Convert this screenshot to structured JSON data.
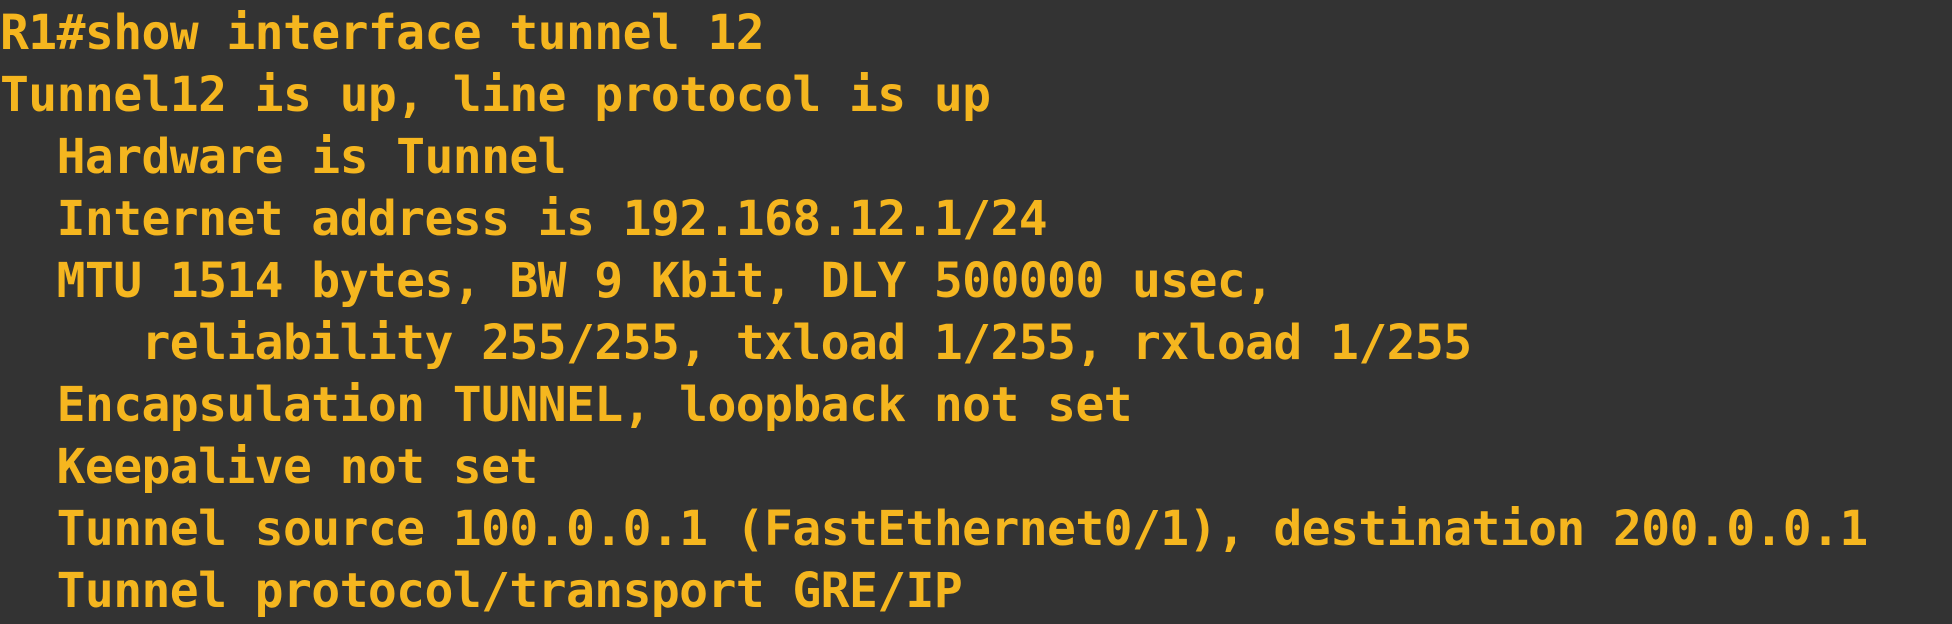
{
  "terminal": {
    "text_color": "#F5B61F",
    "background_color": "#333333",
    "lines": [
      "R1#show interface tunnel 12",
      "Tunnel12 is up, line protocol is up",
      "  Hardware is Tunnel",
      "  Internet address is 192.168.12.1/24",
      "  MTU 1514 bytes, BW 9 Kbit, DLY 500000 usec,",
      "     reliability 255/255, txload 1/255, rxload 1/255",
      "  Encapsulation TUNNEL, loopback not set",
      "  Keepalive not set",
      "  Tunnel source 100.0.0.1 (FastEthernet0/1), destination 200.0.0.1",
      "  Tunnel protocol/transport GRE/IP"
    ]
  }
}
